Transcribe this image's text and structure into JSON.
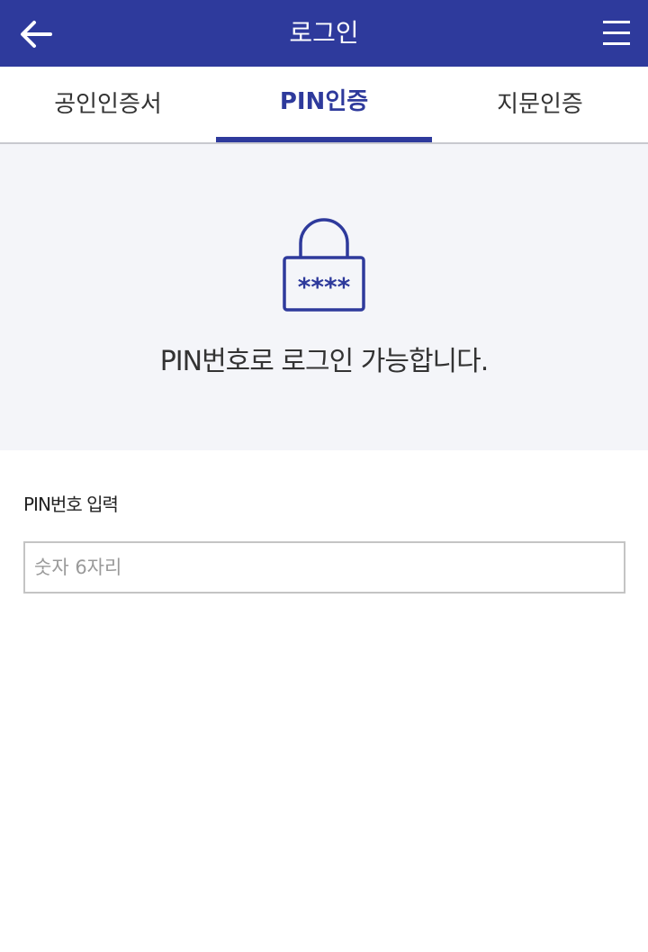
{
  "header": {
    "title": "로그인",
    "back_icon": "arrow-left-icon",
    "menu_icon": "hamburger-menu-icon"
  },
  "tabs": [
    {
      "label": "공인인증서",
      "active": false
    },
    {
      "label": "PIN인증",
      "active": true
    },
    {
      "label": "지문인증",
      "active": false
    }
  ],
  "hero": {
    "icon": "lock-icon",
    "lock_mask": "****",
    "message": "PIN번호로 로그인 가능합니다."
  },
  "pin_field": {
    "label": "PIN번호 입력",
    "placeholder": "숫자 6자리",
    "value": ""
  },
  "colors": {
    "primary": "#2e3a9c",
    "hero_bg": "#f4f5f9",
    "border": "#c4c4c4"
  }
}
